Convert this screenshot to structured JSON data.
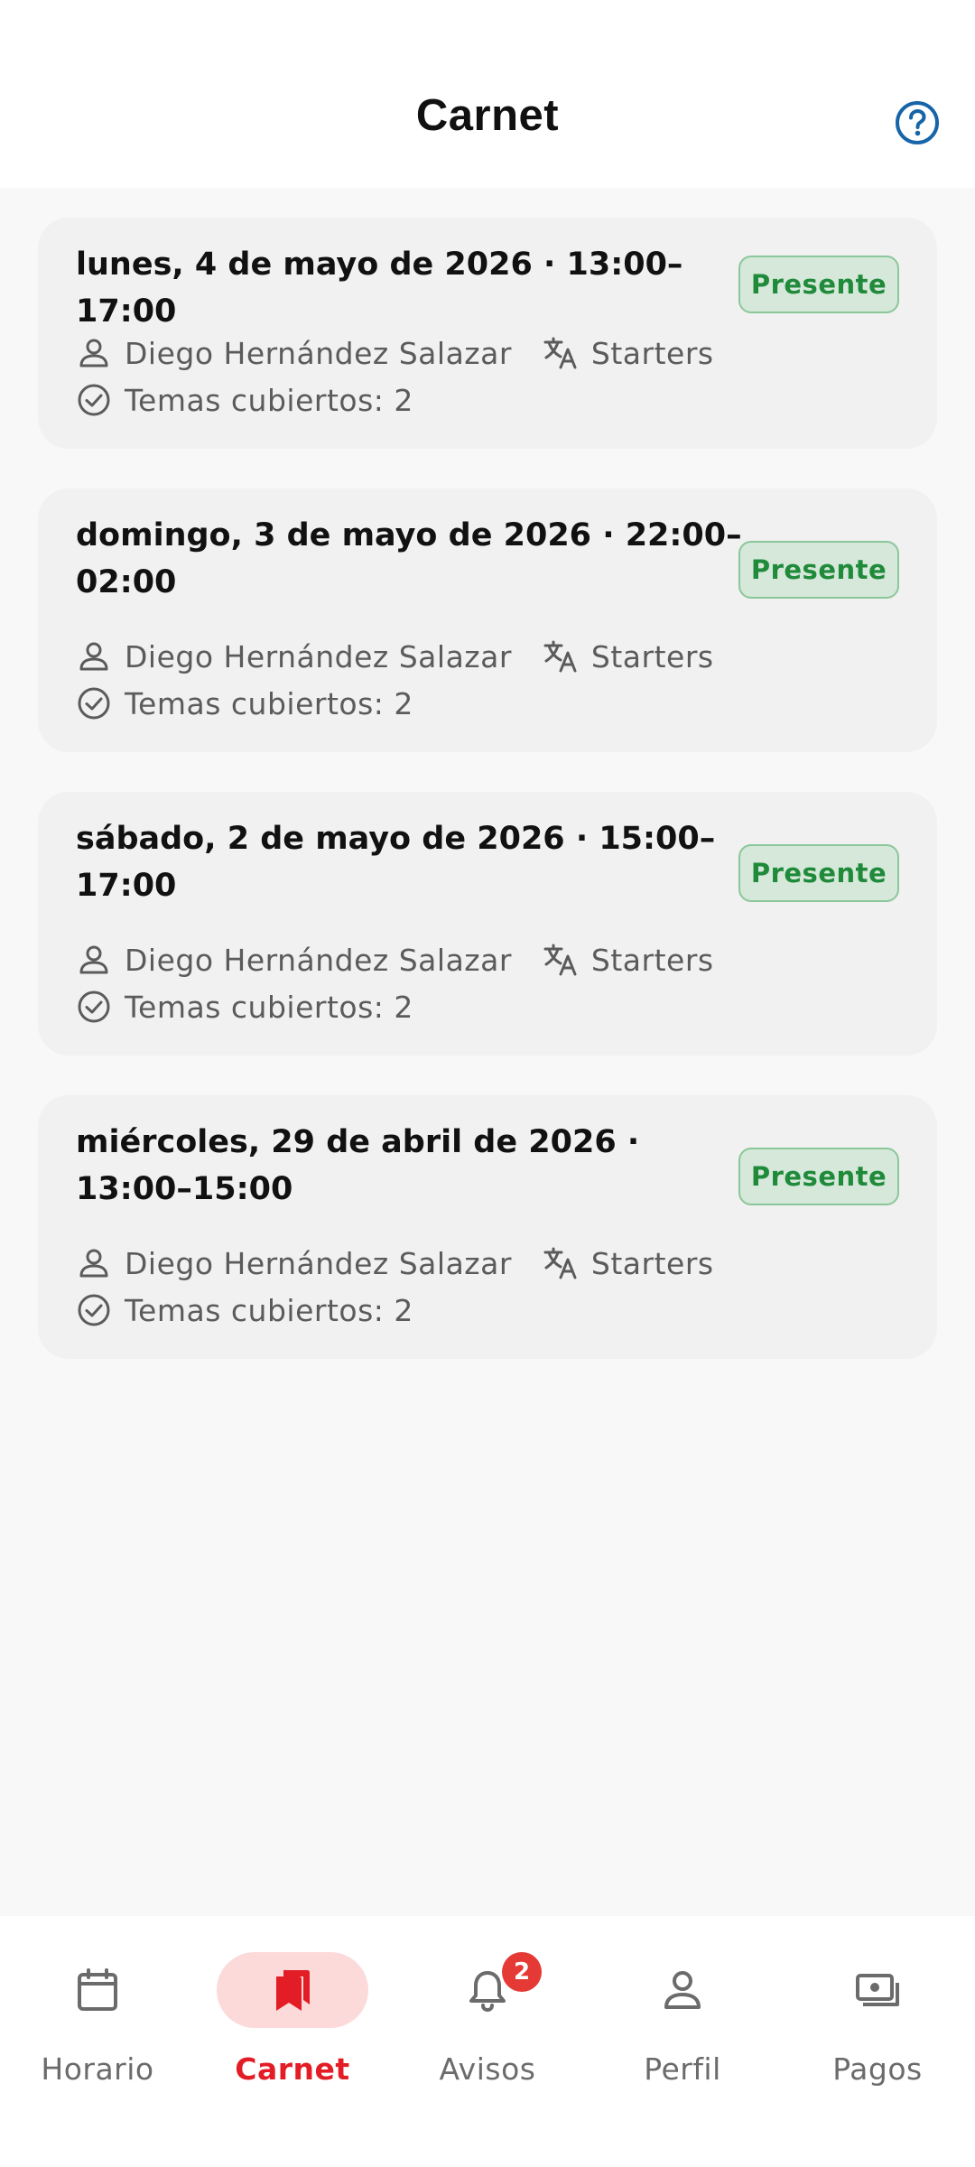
{
  "header": {
    "title": "Carnet",
    "help_icon": "help-circle-icon"
  },
  "sessions": [
    {
      "title": "lunes, 4 de mayo de 2026 · 13:00–17:00",
      "status": "Presente",
      "teacher": "Diego Hernández Salazar",
      "level": "Starters",
      "topics": "Temas cubiertos: 2"
    },
    {
      "title": "domingo, 3 de mayo de 2026 · 22:00–02:00",
      "status": "Presente",
      "teacher": "Diego Hernández Salazar",
      "level": "Starters",
      "topics": "Temas cubiertos: 2"
    },
    {
      "title": "sábado, 2 de mayo de 2026 · 15:00–17:00",
      "status": "Presente",
      "teacher": "Diego Hernández Salazar",
      "level": "Starters",
      "topics": "Temas cubiertos: 2"
    },
    {
      "title": "miércoles, 29 de abril de 2026 · 13:00–15:00",
      "status": "Presente",
      "teacher": "Diego Hernández Salazar",
      "level": "Starters",
      "topics": "Temas cubiertos: 2"
    }
  ],
  "nav": {
    "items": [
      {
        "label": "Horario",
        "icon": "calendar-icon",
        "active": false
      },
      {
        "label": "Carnet",
        "icon": "bookmarks-icon",
        "active": true
      },
      {
        "label": "Avisos",
        "icon": "bell-icon",
        "active": false,
        "badge": "2"
      },
      {
        "label": "Perfil",
        "icon": "person-icon",
        "active": false
      },
      {
        "label": "Pagos",
        "icon": "payments-icon",
        "active": false
      }
    ]
  },
  "colors": {
    "accent": "#e31d25",
    "help": "#1565a8",
    "status_text": "#1f8a3a",
    "status_bg": "#d5e8da",
    "status_border": "#8cc79a",
    "notif_badge": "#e53935"
  }
}
